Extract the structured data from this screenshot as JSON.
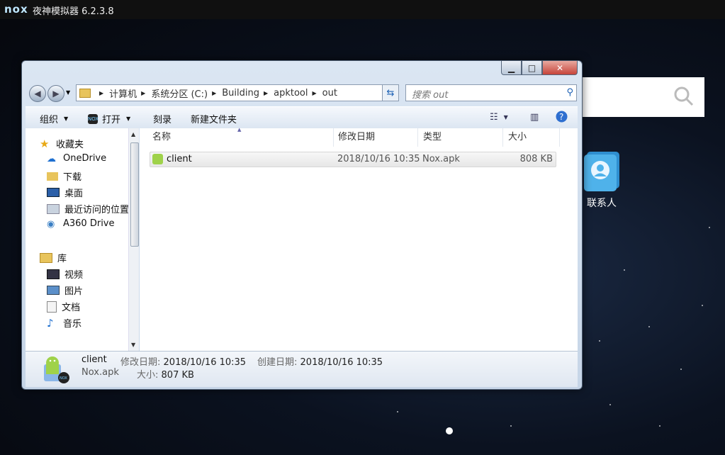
{
  "emulator": {
    "logo": "nox",
    "title": "夜神模拟器 6.2.3.8"
  },
  "android": {
    "contacts_label": "联系人"
  },
  "explorer": {
    "window_controls": [
      "minimize-icon",
      "maximize-icon",
      "close-icon"
    ],
    "breadcrumbs": [
      "计算机",
      "系统分区 (C:)",
      "Building",
      "apktool",
      "out"
    ],
    "search_placeholder": "搜索 out",
    "toolbar": {
      "organize": "组织",
      "open": "打开",
      "burn": "刻录",
      "new_folder": "新建文件夹"
    },
    "nav": {
      "favorites_header": "收藏夹",
      "favorites": [
        "OneDrive",
        "下载",
        "桌面",
        "最近访问的位置",
        "A360 Drive"
      ],
      "libraries_header": "库",
      "libraries": [
        "视频",
        "图片",
        "文档",
        "音乐"
      ]
    },
    "columns": [
      "名称",
      "修改日期",
      "类型",
      "大小"
    ],
    "files": [
      {
        "name": "client",
        "modified": "2018/10/16 10:35",
        "type": "Nox.apk",
        "size": "808 KB"
      }
    ],
    "details": {
      "name": "client",
      "type": "Nox.apk",
      "modified_label": "修改日期:",
      "modified": "2018/10/16 10:35",
      "created_label": "创建日期:",
      "created": "2018/10/16 10:35",
      "size_label": "大小:",
      "size": "807 KB"
    }
  }
}
